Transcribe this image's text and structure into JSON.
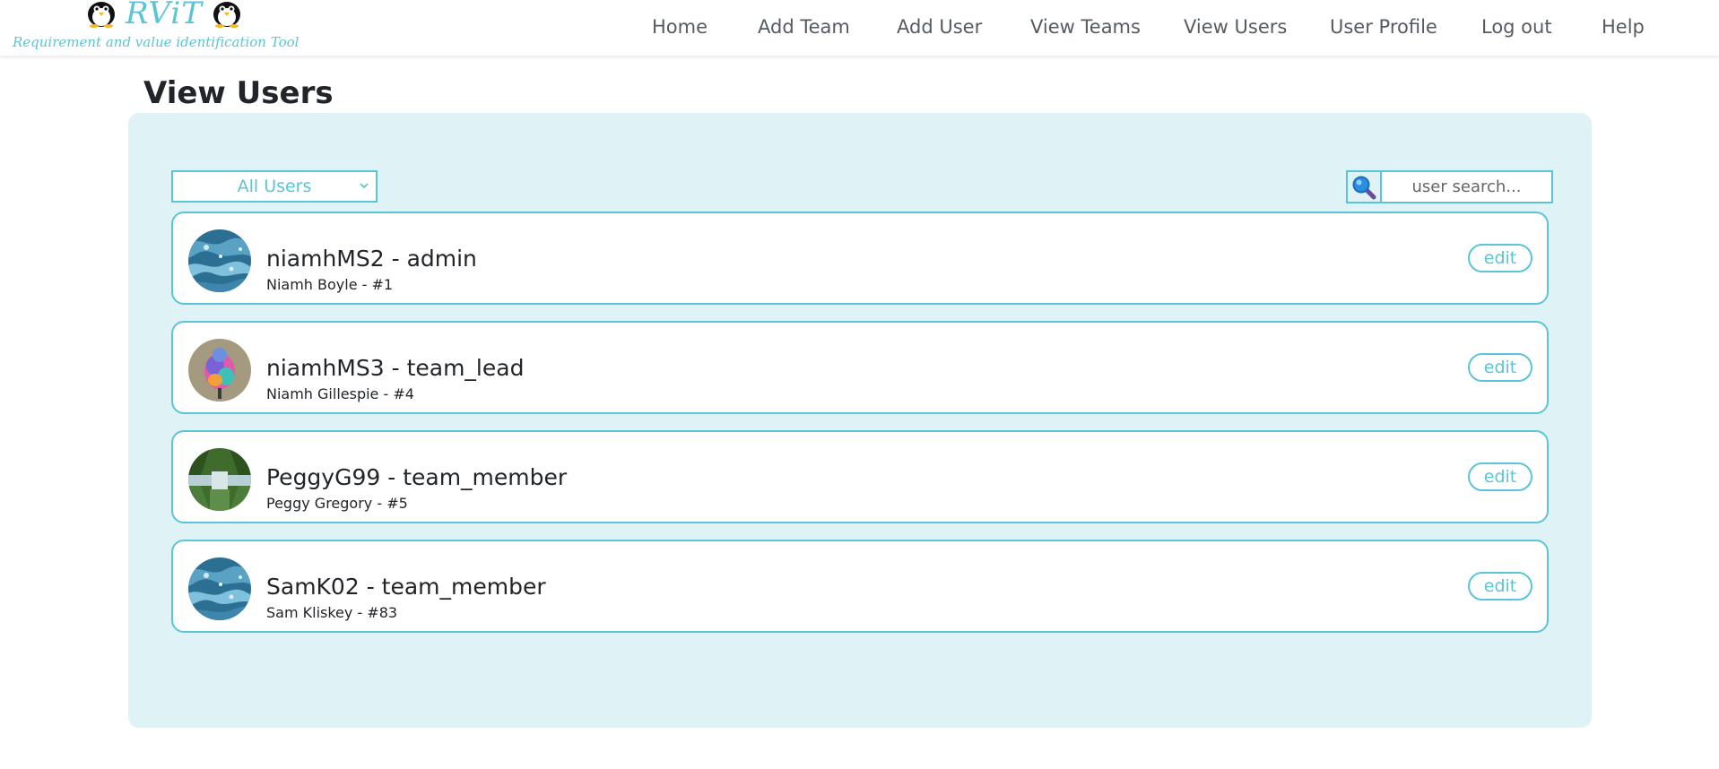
{
  "header": {
    "logo_text": "RViT",
    "logo_subtitle": "Requirement and value identification Tool",
    "nav": [
      {
        "label": "Home"
      },
      {
        "label": "Add Team"
      },
      {
        "label": "Add User"
      },
      {
        "label": "View Teams"
      },
      {
        "label": "View Users"
      },
      {
        "label": "User Profile"
      },
      {
        "label": "Log out"
      },
      {
        "label": "Help"
      }
    ]
  },
  "page": {
    "title": "View Users"
  },
  "filter": {
    "selected": "All Users"
  },
  "search": {
    "placeholder": "user search...",
    "icon": "magnifier-icon"
  },
  "users": [
    {
      "title": "niamhMS2 - admin",
      "subtitle": "Niamh Boyle - #1",
      "action": "edit",
      "avatar": "ocean-water"
    },
    {
      "title": "niamhMS3 - team_lead",
      "subtitle": "Niamh Gillespie - #4",
      "action": "edit",
      "avatar": "colorful-bird"
    },
    {
      "title": "PeggyG99 - team_member",
      "subtitle": "Peggy Gregory - #5",
      "action": "edit",
      "avatar": "forest-lake"
    },
    {
      "title": "SamK02 - team_member",
      "subtitle": "Sam Kliskey - #83",
      "action": "edit",
      "avatar": "ocean-water"
    }
  ],
  "colors": {
    "accent": "#5bc4d6",
    "panel": "#dff2f6",
    "text": "#212529"
  }
}
